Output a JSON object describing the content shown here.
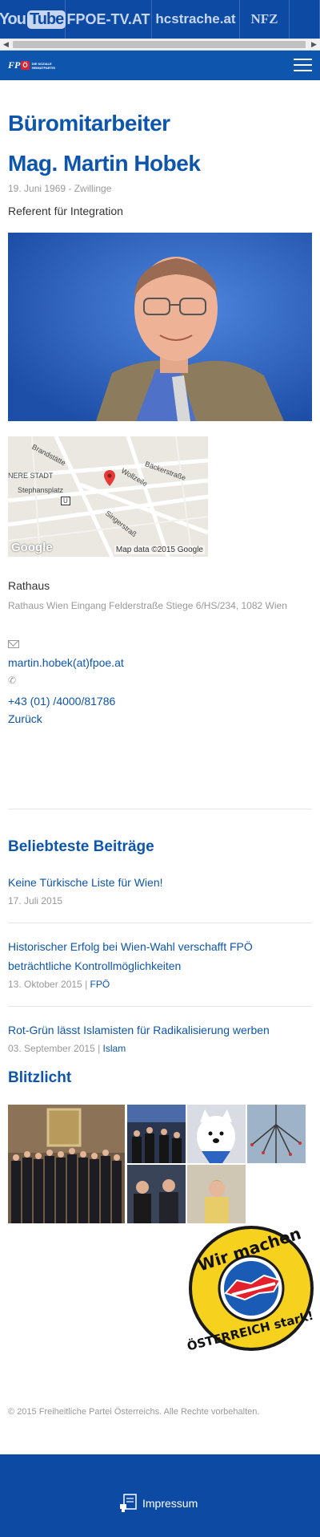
{
  "topbar": {
    "links": [
      {
        "you": "You",
        "tube": "Tube"
      },
      {
        "label": "FPOE-TV.AT"
      },
      {
        "pre": "hc",
        "bold": "strache",
        "post": ".at"
      },
      {
        "label": "NFZ"
      }
    ]
  },
  "nav": {
    "logo_fp": "FP",
    "logo_badge": "Ö",
    "logo_sub": "DIE SOZIALE HEIMATPARTEI"
  },
  "profile": {
    "role": "Büromitarbeiter",
    "name": "Mag. Martin Hobek",
    "dob": "19. Juni 1969 - Zwillinge",
    "position": "Referent für Integration"
  },
  "map": {
    "labels": [
      "Brandstätte",
      "NERE STADT",
      "Stephansplatz",
      "Bäckerstraße",
      "Wollzeile",
      "Singerstraß"
    ],
    "marker": "U",
    "google": "Google",
    "credit": "Map data ©2015 Google"
  },
  "contact": {
    "location": "Rathaus",
    "address": "Rathaus Wien Eingang Felderstraße Stiege 6/HS/234, 1082 Wien",
    "email": "martin.hobek(at)fpoe.at",
    "phone": "+43 (01) /4000/81786",
    "back": "Zurück"
  },
  "popular": {
    "heading": "Beliebteste Beiträge",
    "posts": [
      {
        "title": "Keine Türkische Liste für Wien!",
        "date": "17. Juli 2015",
        "tag": ""
      },
      {
        "title": "Historischer Erfolg bei Wien-Wahl verschafft FPÖ beträchtliche Kontrollmöglichkeiten",
        "date": "13. Oktober 2015 |",
        "tag": "FPÖ"
      },
      {
        "title": "Rot-Grün lässt Islamisten für Radikalisierung werben",
        "date": "03. September 2015 |",
        "tag": "Islam"
      }
    ]
  },
  "blitzlicht": {
    "heading": "Blitzlicht"
  },
  "sticker": {
    "top": "Wir machen",
    "bottom": "ÖSTERREICH stark!"
  },
  "footer": {
    "copyright": "© 2015 Freiheitliche Partei Österreichs. Alle Rechte vorbehalten.",
    "impressum": "Impressum"
  },
  "colors": {
    "brand_blue": "#0d55ad",
    "dark_blue": "#0d4aa3",
    "red": "#e3202c",
    "sticker_yellow": "#f6d21e"
  }
}
